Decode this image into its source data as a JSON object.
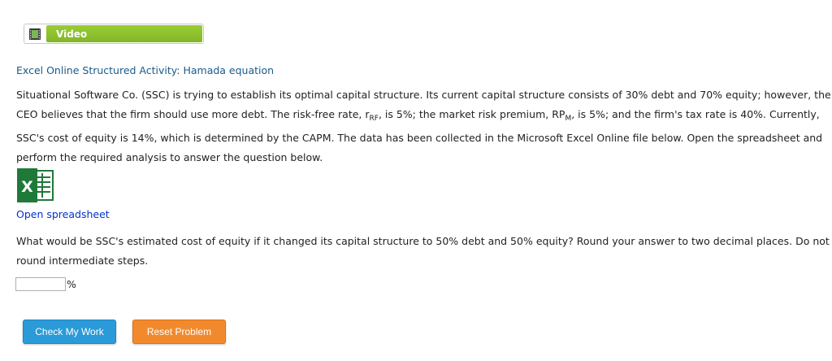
{
  "video": {
    "label": "Video"
  },
  "activity_title": "Excel Online Structured Activity: Hamada equation",
  "paragraph": {
    "l1": "Situational Software Co. (SSC) is trying to establish its optimal capital structure. Its current capital structure consists of 30% debt and 70% equity; however, the",
    "l2_a": "CEO believes that the firm should use more debt. The risk-free rate, r",
    "l2_sub1": "RF",
    "l2_b": ", is 5%; the market risk premium, RP",
    "l2_sub2": "M",
    "l2_c": ", is 5%; and the firm's tax rate is 40%. Currently,",
    "l3": "SSC's cost of equity is 14%, which is determined by the CAPM. The data has been collected in the Microsoft Excel Online file below. Open the spreadsheet and",
    "l4": "perform the required analysis to answer the question below."
  },
  "open_spreadsheet": "Open spreadsheet",
  "question": {
    "l1": "What would be SSC's estimated cost of equity if it changed its capital structure to 50% debt and 50% equity? Round your answer to two decimal places. Do not",
    "l2": "round intermediate steps."
  },
  "answer": {
    "value": "",
    "unit": "%"
  },
  "buttons": {
    "check": "Check My Work",
    "reset": "Reset Problem"
  },
  "colors": {
    "video_green": "#9acd32",
    "excel_green": "#1f7a3a",
    "check_blue": "#2a9ad8",
    "reset_orange": "#f28a2d",
    "link_blue": "#0033cc"
  },
  "icons": {
    "video": "film-icon",
    "excel": "excel-icon"
  }
}
